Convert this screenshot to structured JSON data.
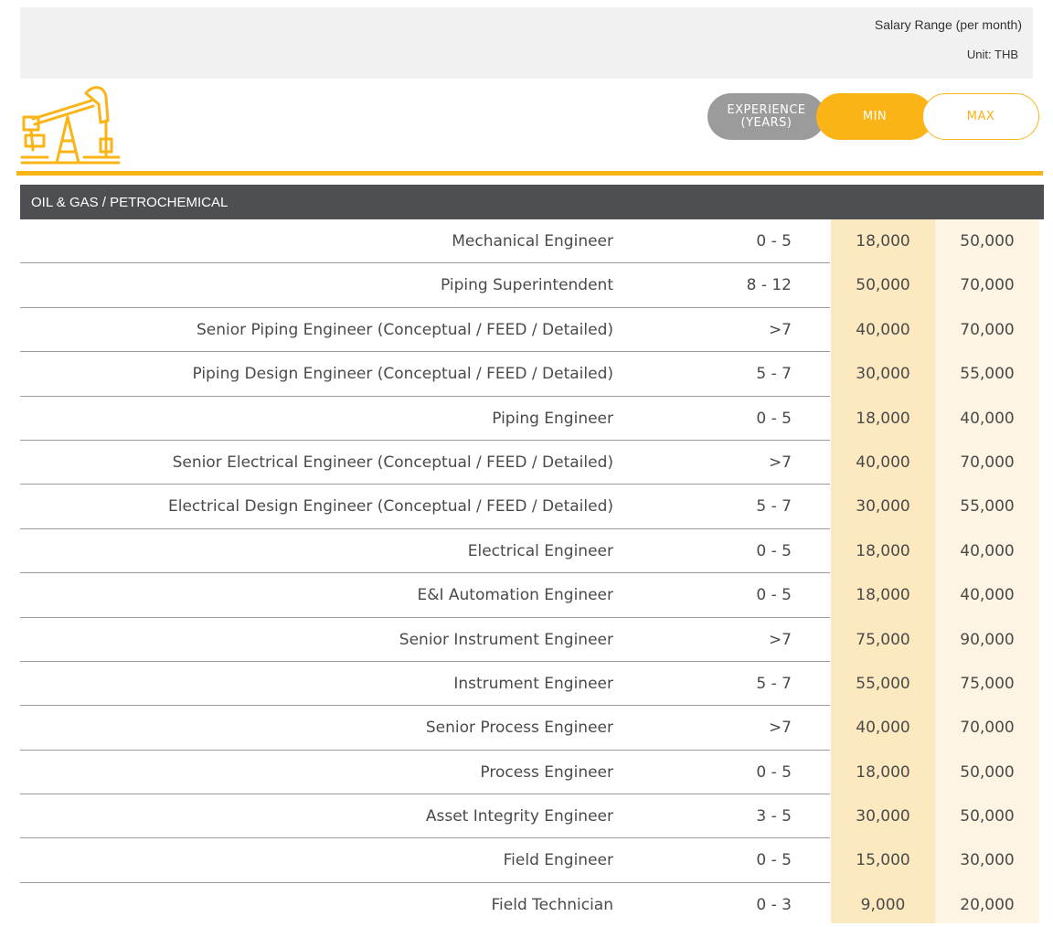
{
  "header": {
    "salary_range": "Salary Range  (per month)",
    "unit": "Unit: THB"
  },
  "icons": {
    "section_icon": "oil-pump-jack-icon"
  },
  "columns": {
    "experience": "EXPERIENCE\n(YEARS)",
    "min": "MIN",
    "max": "MAX"
  },
  "colors": {
    "accent": "#fbb416",
    "section_bar": "#4d4f53",
    "experience_pill": "#9b9b9b",
    "min_column": "#fde9c0",
    "max_column": "#fdf4e3",
    "top_bar": "#f1f1f1"
  },
  "section": {
    "title": "OIL & GAS / PETROCHEMICAL"
  },
  "rows": [
    {
      "title": "Mechanical Engineer",
      "experience": "0 - 5",
      "min": "18,000",
      "max": "50,000"
    },
    {
      "title": "Piping Superintendent",
      "experience": "8 - 12",
      "min": "50,000",
      "max": "70,000"
    },
    {
      "title": "Senior Piping Engineer  (Conceptual / FEED / Detailed)",
      "experience": ">7",
      "min": "40,000",
      "max": "70,000"
    },
    {
      "title": "Piping Design Engineer  (Conceptual / FEED / Detailed)",
      "experience": "5 - 7",
      "min": "30,000",
      "max": "55,000"
    },
    {
      "title": "Piping Engineer",
      "experience": "0 - 5",
      "min": "18,000",
      "max": "40,000"
    },
    {
      "title": "Senior Electrical Engineer (Conceptual / FEED / Detailed)",
      "experience": ">7",
      "min": "40,000",
      "max": "70,000"
    },
    {
      "title": "Electrical Design Engineer (Conceptual / FEED / Detailed)",
      "experience": "5 - 7",
      "min": "30,000",
      "max": "55,000"
    },
    {
      "title": "Electrical Engineer",
      "experience": "0 - 5",
      "min": "18,000",
      "max": "40,000"
    },
    {
      "title": "E&I Automation Engineer",
      "experience": "0 - 5",
      "min": "18,000",
      "max": "40,000"
    },
    {
      "title": "Senior Instrument Engineer",
      "experience": ">7",
      "min": "75,000",
      "max": "90,000"
    },
    {
      "title": "Instrument Engineer",
      "experience": "5 - 7",
      "min": "55,000",
      "max": "75,000"
    },
    {
      "title": "Senior Process Engineer",
      "experience": ">7",
      "min": "40,000",
      "max": "70,000"
    },
    {
      "title": "Process Engineer",
      "experience": "0 - 5",
      "min": "18,000",
      "max": "50,000"
    },
    {
      "title": "Asset Integrity Engineer",
      "experience": "3 - 5",
      "min": "30,000",
      "max": "50,000"
    },
    {
      "title": "Field Engineer",
      "experience": "0 - 5",
      "min": "15,000",
      "max": "30,000"
    },
    {
      "title": "Field Technician",
      "experience": "0 - 3",
      "min": "9,000",
      "max": "20,000"
    }
  ]
}
